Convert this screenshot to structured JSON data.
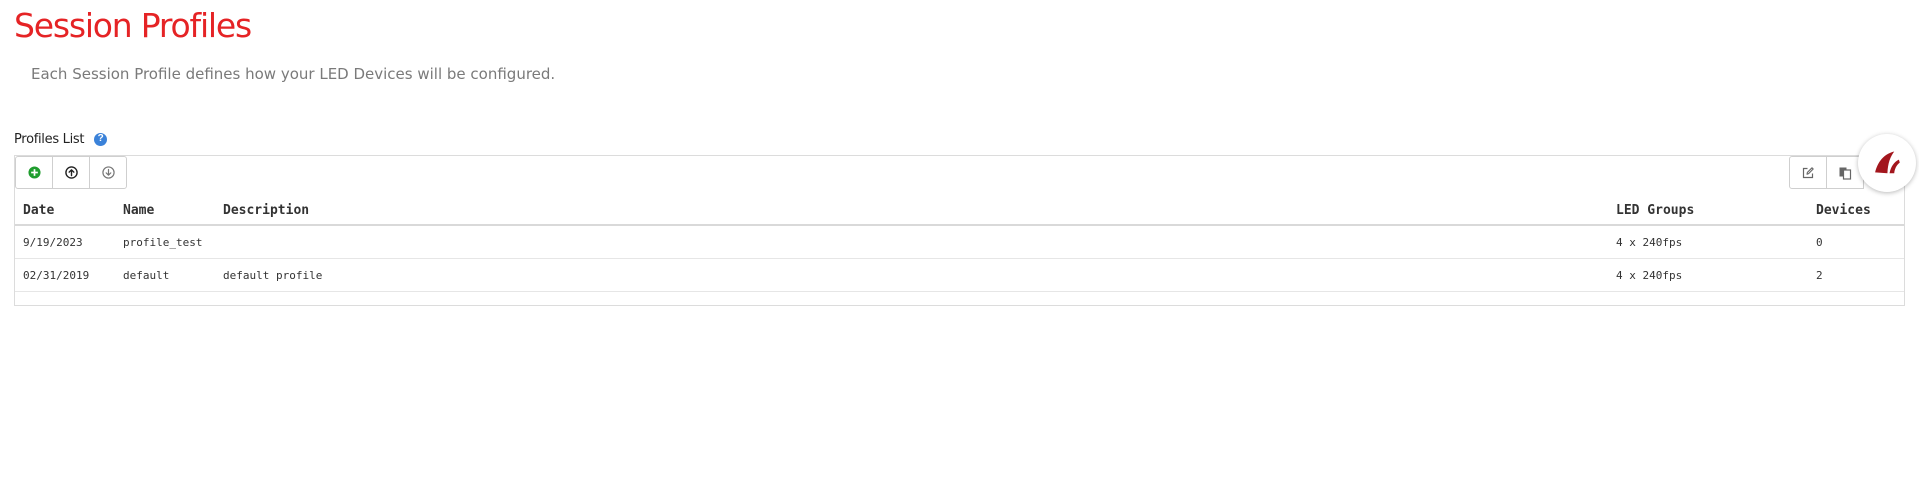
{
  "page": {
    "title": "Session Profiles",
    "subtitle": "Each Session Profile defines how your LED Devices will be configured."
  },
  "profiles_section": {
    "label": "Profiles List",
    "help_icon": "question-circle-icon"
  },
  "toolbar": {
    "left_icons": [
      "add-circle-icon",
      "upload-circle-icon",
      "download-circle-icon"
    ],
    "right_icons": [
      "edit-icon",
      "copy-icon"
    ]
  },
  "table": {
    "columns": [
      "Date",
      "Name",
      "Description",
      "LED Groups",
      "Devices"
    ],
    "rows": [
      {
        "date": "9/19/2023",
        "name": "profile_test",
        "description": "",
        "led_groups": "4 x 240fps",
        "devices": "0"
      },
      {
        "date": "02/31/2019",
        "name": "default",
        "description": "default profile",
        "led_groups": "4 x 240fps",
        "devices": "2"
      }
    ]
  },
  "colors": {
    "title": "#e52325",
    "add_icon": "#1f9d2e",
    "help_icon": "#3b82d9",
    "logo": "#a3161d"
  }
}
